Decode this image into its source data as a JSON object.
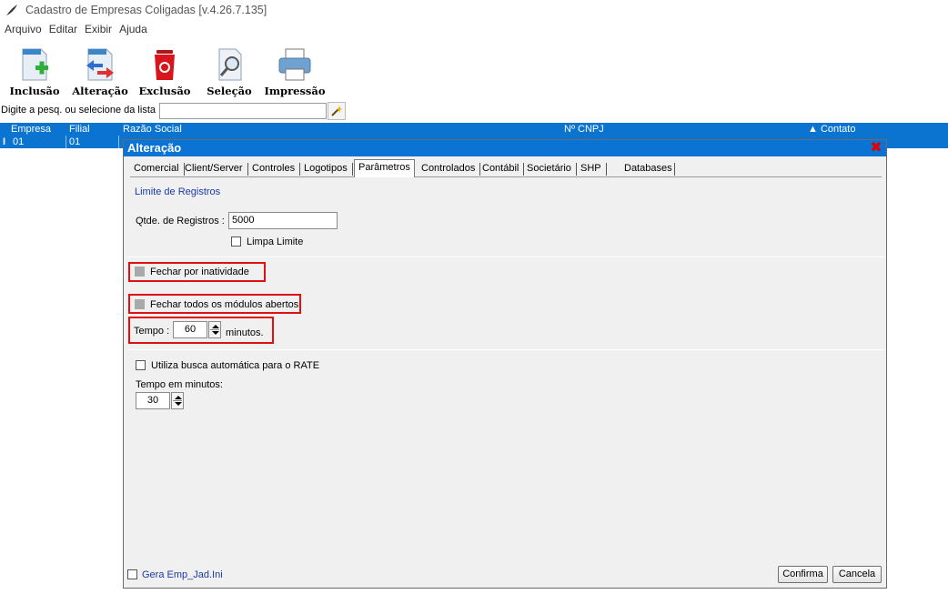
{
  "window": {
    "title": "Cadastro de Empresas Coligadas [v.4.26.7.135]",
    "app_icon": "quill-icon"
  },
  "menu": [
    "Arquivo",
    "Editar",
    "Exibir",
    "Ajuda"
  ],
  "toolbar": {
    "inclusao": "Inclusão",
    "alteracao": "Alteração",
    "exclusao": "Exclusão",
    "selecao": "Seleção",
    "impressao": "Impressão"
  },
  "search": {
    "label": "Digite a pesq. ou selecione da lista :",
    "value": ""
  },
  "grid": {
    "columns": {
      "empresa": "Empresa",
      "filial": "Filial",
      "razao_social": "Razão Social",
      "cnpj": "Nº CNPJ",
      "contato": "▲ Contato"
    },
    "row": {
      "indicator": "I",
      "empresa": "01",
      "filial": "01"
    }
  },
  "dialog": {
    "title": "Alteração",
    "tabs": [
      "Comercial",
      "Client/Server",
      "Controles",
      "Logotipos",
      "Parâmetros",
      "Controlados",
      "Contábil",
      "Societário",
      "SHP",
      "Databases"
    ],
    "active_tab": "Parâmetros",
    "section_title": "Limite de Registros",
    "qtde_label": "Qtde. de Registros :",
    "qtde_value": "5000",
    "limpa_limite": "Limpa Limite",
    "fechar_inatividade": "Fechar por inatividade",
    "fechar_modulos": "Fechar todos os módulos abertos",
    "tempo_label": "Tempo :",
    "tempo_value": "60",
    "minutos": "minutos.",
    "rate_label": "Utiliza busca automática para o RATE",
    "tempo_minutos_label": "Tempo em minutos:",
    "tempo_minutos_value": "30",
    "gera_label": "Gera Emp_Jad.Ini",
    "confirma": "Confirma",
    "cancela": "Cancela"
  },
  "colors": {
    "grid_blue": "#0a74d0",
    "highlight_red": "#e01010",
    "section_blue": "#1a3aa6"
  }
}
